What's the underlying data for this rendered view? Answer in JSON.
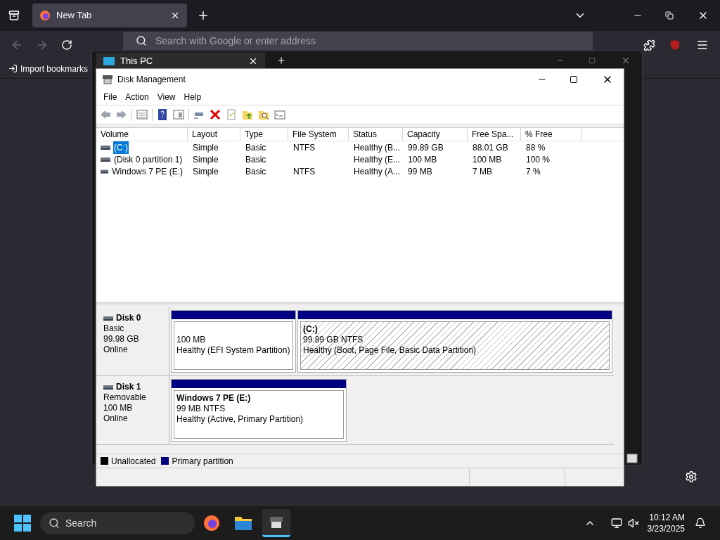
{
  "browser": {
    "tabs": [
      {
        "label": "New Tab",
        "selected": true
      }
    ],
    "address": {
      "placeholder": "Search with Google or enter address"
    },
    "bookmarks": [
      "Import bookmarks"
    ]
  },
  "explorer": {
    "tab": "This PC"
  },
  "window": {
    "title": "Disk Management"
  },
  "menu": [
    "File",
    "Action",
    "View",
    "Help"
  ],
  "table": {
    "columns": [
      "Volume",
      "Layout",
      "Type",
      "File System",
      "Status",
      "Capacity",
      "Free Spa...",
      "% Free"
    ],
    "rows": [
      {
        "selected": true,
        "cells": [
          "(C:)",
          "Simple",
          "Basic",
          "NTFS",
          "Healthy (B...",
          "99.89 GB",
          "88.01 GB",
          "88 %"
        ]
      },
      {
        "selected": false,
        "cells": [
          "(Disk 0 partition 1)",
          "Simple",
          "Basic",
          "",
          "Healthy (E...",
          "100 MB",
          "100 MB",
          "100 %"
        ]
      },
      {
        "selected": false,
        "cells": [
          "Windows 7 PE (E:)",
          "Simple",
          "Basic",
          "NTFS",
          "Healthy (A...",
          "99 MB",
          "7 MB",
          "7 %"
        ]
      }
    ]
  },
  "disks": [
    {
      "name": "Disk 0",
      "lines": [
        "Basic",
        "99.98 GB",
        "Online"
      ],
      "partitions": [
        {
          "kind": "primary",
          "selected": false,
          "lines": [
            "100 MB",
            "Healthy (EFI System Partition)"
          ]
        },
        {
          "kind": "primary",
          "selected": true,
          "title": "(C:)",
          "lines": [
            "99.89 GB NTFS",
            "Healthy (Boot, Page File, Basic Data Partition)"
          ]
        }
      ]
    },
    {
      "name": "Disk 1",
      "lines": [
        "Removable",
        "100 MB",
        "Online"
      ],
      "partitions": [
        {
          "kind": "primary",
          "selected": false,
          "title": "Windows 7 PE  (E:)",
          "lines": [
            "99 MB NTFS",
            "Healthy (Active, Primary Partition)"
          ]
        }
      ]
    }
  ],
  "legend": [
    {
      "label": "Unallocated",
      "color": "#000000"
    },
    {
      "label": "Primary partition",
      "color": "#000080"
    }
  ],
  "taskbar": {
    "search": "Search",
    "time": "10:12 AM",
    "date": "3/23/2025"
  }
}
